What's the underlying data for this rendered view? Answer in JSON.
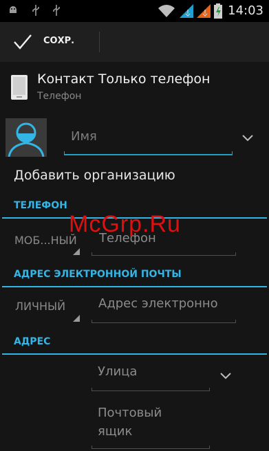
{
  "status_bar": {
    "time": "14:03",
    "icons": [
      "android-debug-icon",
      "usb-icon",
      "usb-icon",
      "wifi-icon",
      "signal-icon",
      "signal-icon",
      "battery-icon"
    ]
  },
  "action_bar": {
    "done_label": "СОХР."
  },
  "account": {
    "title": "Контакт Только телефон",
    "subtitle": "Телефон"
  },
  "name": {
    "placeholder": "Имя"
  },
  "add_org_label": "Добавить организацию",
  "sections": {
    "phone": {
      "header": "ТЕЛЕФОН",
      "type": "МОБ...НЫЙ",
      "placeholder": "Телефон"
    },
    "email": {
      "header": "АДРЕС ЭЛЕКТРОННОЙ ПОЧТЫ",
      "type": "ЛИЧНЫЙ",
      "placeholder": "Адрес электронно"
    },
    "address": {
      "header": "АДРЕС",
      "street_placeholder": "Улица",
      "pobox_placeholder_line1": "Почтовый",
      "pobox_placeholder_line2": "ящик"
    }
  },
  "watermark": "McGrp.Ru",
  "colors": {
    "accent": "#33b5e5",
    "background": "#151515",
    "watermark": "#e01010"
  }
}
